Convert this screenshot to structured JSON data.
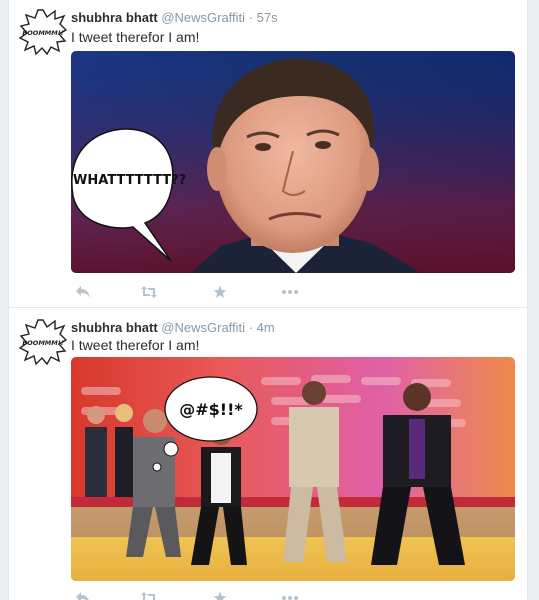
{
  "tweets": [
    {
      "author_name": "shubhra bhatt",
      "author_handle": "@NewsGraffiti",
      "separator": "·",
      "timestamp": "57s",
      "text": "I tweet therefor I am!",
      "avatar_caption": "BOOMMM!!",
      "image_speech": "WHATTTTTTT??"
    },
    {
      "author_name": "shubhra bhatt",
      "author_handle": "@NewsGraffiti",
      "separator": "·",
      "timestamp": "4m",
      "text": "I tweet therefor I am!",
      "avatar_caption": "BOOMMM!!",
      "image_speech": "@#$!!*"
    }
  ],
  "actions": [
    "reply-icon",
    "retweet-icon",
    "favorite-star-icon",
    "more-dots-icon"
  ],
  "colors": {
    "name": "#292f33",
    "meta": "#8899a6",
    "action_icon": "#b7c3cc",
    "divider": "#e1e8ed",
    "page_bg": "#e9edf0"
  }
}
